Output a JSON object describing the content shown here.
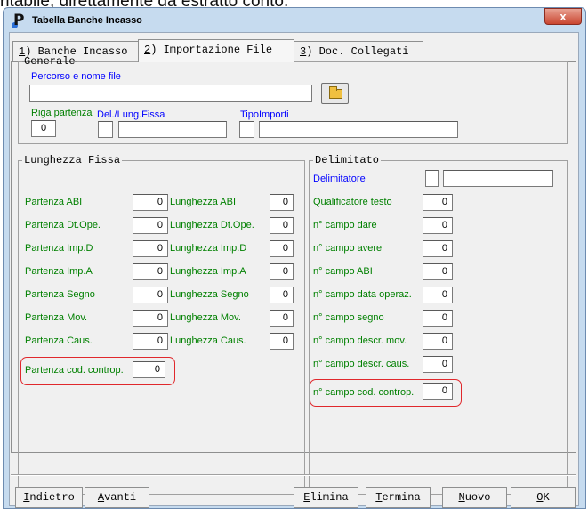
{
  "top_caption": "ritabile, direttamente da estratto conto.",
  "window": {
    "title": "Tabella Banche Incasso",
    "close_glyph": "x",
    "icon": "app-p-icon"
  },
  "tabs": [
    {
      "num": "1",
      "label": ") Banche Incasso"
    },
    {
      "num": "2",
      "label": ") Importazione File"
    },
    {
      "num": "3",
      "label": ") Doc. Collegati"
    }
  ],
  "generale": {
    "legend": "Generale",
    "path_label": "Percorso e nome file",
    "path_value": "",
    "riga_label": "Riga partenza",
    "riga_value": "0",
    "del_label": "Del./Lung.Fissa",
    "del_value": "",
    "del_value2": "",
    "tipo_label": "TipoImporti",
    "tipo_value": "",
    "tipo_value2": ""
  },
  "lunghezza": {
    "legend": "Lunghezza Fissa",
    "rows": [
      {
        "pl": "Partenza ABI",
        "pv": "0",
        "ll": "Lunghezza ABI",
        "lv": "0"
      },
      {
        "pl": "Partenza Dt.Ope.",
        "pv": "0",
        "ll": "Lunghezza Dt.Ope.",
        "lv": "0"
      },
      {
        "pl": "Partenza Imp.D",
        "pv": "0",
        "ll": "Lunghezza Imp.D",
        "lv": "0"
      },
      {
        "pl": "Partenza Imp.A",
        "pv": "0",
        "ll": "Lunghezza Imp.A",
        "lv": "0"
      },
      {
        "pl": "Partenza Segno",
        "pv": "0",
        "ll": "Lunghezza Segno",
        "lv": "0"
      },
      {
        "pl": "Partenza Mov.",
        "pv": "0",
        "ll": "Lunghezza Mov.",
        "lv": "0"
      },
      {
        "pl": "Partenza Caus.",
        "pv": "0",
        "ll": "Lunghezza Caus.",
        "lv": "0"
      }
    ],
    "contrap_label": "Partenza cod. controp.",
    "contrap_value": "0"
  },
  "delimitato": {
    "legend": "Delimitato",
    "delimitatore_label": "Delimitatore",
    "delimitatore_value": "",
    "delimitatore_value2": "",
    "rows": [
      {
        "label": "Qualificatore testo",
        "value": "0"
      },
      {
        "label": "n° campo dare",
        "value": "0"
      },
      {
        "label": "n° campo avere",
        "value": "0"
      },
      {
        "label": "n° campo ABI",
        "value": "0"
      },
      {
        "label": "n° campo data operaz.",
        "value": "0"
      },
      {
        "label": "n° campo segno",
        "value": "0"
      },
      {
        "label": "n° campo descr. mov.",
        "value": "0"
      },
      {
        "label": "n° campo descr. caus.",
        "value": "0"
      },
      {
        "label": "n° campo cod. controp.",
        "value": "0"
      }
    ]
  },
  "buttons": {
    "indietro": {
      "hot": "I",
      "rest": "ndietro"
    },
    "avanti": {
      "hot": "A",
      "rest": "vanti"
    },
    "elimina": {
      "hot": "E",
      "rest": "limina"
    },
    "termina": {
      "hot": "T",
      "rest": "ermina"
    },
    "nuovo": {
      "hot": "N",
      "rest": "uovo"
    },
    "ok": {
      "hot": "O",
      "rest": "K"
    }
  },
  "colors": {
    "label_green": "#008000",
    "label_blue": "#0000ff",
    "highlight_red": "#e0282c"
  }
}
